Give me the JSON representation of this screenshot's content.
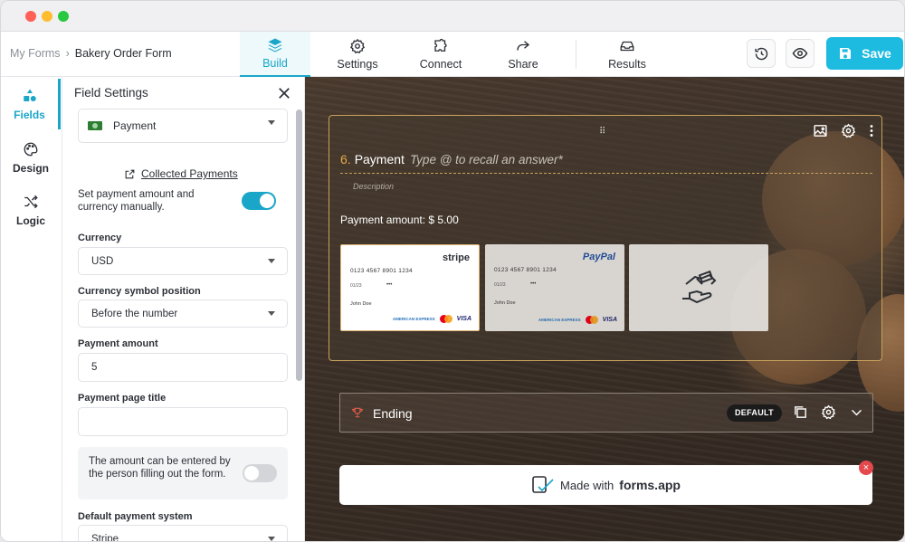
{
  "breadcrumb": {
    "parent": "My Forms",
    "separator": "›",
    "current": "Bakery Order Form"
  },
  "nav": {
    "tabs": [
      {
        "label": "Build",
        "icon": "layers-icon",
        "active": true
      },
      {
        "label": "Settings",
        "icon": "gear-icon"
      },
      {
        "label": "Connect",
        "icon": "puzzle-icon"
      },
      {
        "label": "Share",
        "icon": "share-arrow-icon"
      },
      {
        "label": "Results",
        "icon": "inbox-icon"
      }
    ],
    "save_label": "Save"
  },
  "sidebar": {
    "items": [
      {
        "label": "Fields",
        "icon": "shapes-icon",
        "active": true
      },
      {
        "label": "Design",
        "icon": "palette-icon"
      },
      {
        "label": "Logic",
        "icon": "shuffle-icon"
      }
    ]
  },
  "panel": {
    "title": "Field Settings",
    "field_type": "Payment",
    "collected_link": "Collected Payments",
    "manual_toggle_label": "Set payment amount and currency manually.",
    "manual_toggle_on": true,
    "currency_label": "Currency",
    "currency_value": "USD",
    "symbol_position_label": "Currency symbol position",
    "symbol_position_value": "Before the number",
    "amount_label": "Payment amount",
    "amount_value": "5",
    "page_title_label": "Payment page title",
    "page_title_value": "",
    "editable_amount_text": "The amount can be entered by the person filling out the form.",
    "editable_amount_on": false,
    "default_system_label": "Default payment system",
    "default_system_value": "Stripe"
  },
  "card": {
    "number": "6.",
    "title": "Payment",
    "placeholder": "Type @ to recall an answer*",
    "description": "Description",
    "amount_text": "Payment amount: $ 5.00",
    "options": [
      {
        "brand": "stripe",
        "cc_number": "0123 4567 8901 1234",
        "cc_exp": "01/23",
        "cc_cvv": "•••",
        "cc_name": "John Doe"
      },
      {
        "brand": "PayPal",
        "cc_number": "0123 4567 8901 1234",
        "cc_exp": "01/23",
        "cc_cvv": "•••",
        "cc_name": "John Doe"
      },
      {
        "brand": "",
        "icon": "hand-money-icon"
      }
    ],
    "card_logos": {
      "amex": "AMERICAN EXPRESS",
      "visa": "VISA"
    }
  },
  "ending": {
    "label": "Ending",
    "badge": "DEFAULT"
  },
  "madewith": {
    "prefix": "Made with",
    "brand": "forms.app",
    "close": "×"
  },
  "colors": {
    "accent": "#1aa6c9",
    "save": "#1dbbe0",
    "card_border": "#c7a25d",
    "number": "#e4a94b",
    "close": "#e5484d"
  }
}
